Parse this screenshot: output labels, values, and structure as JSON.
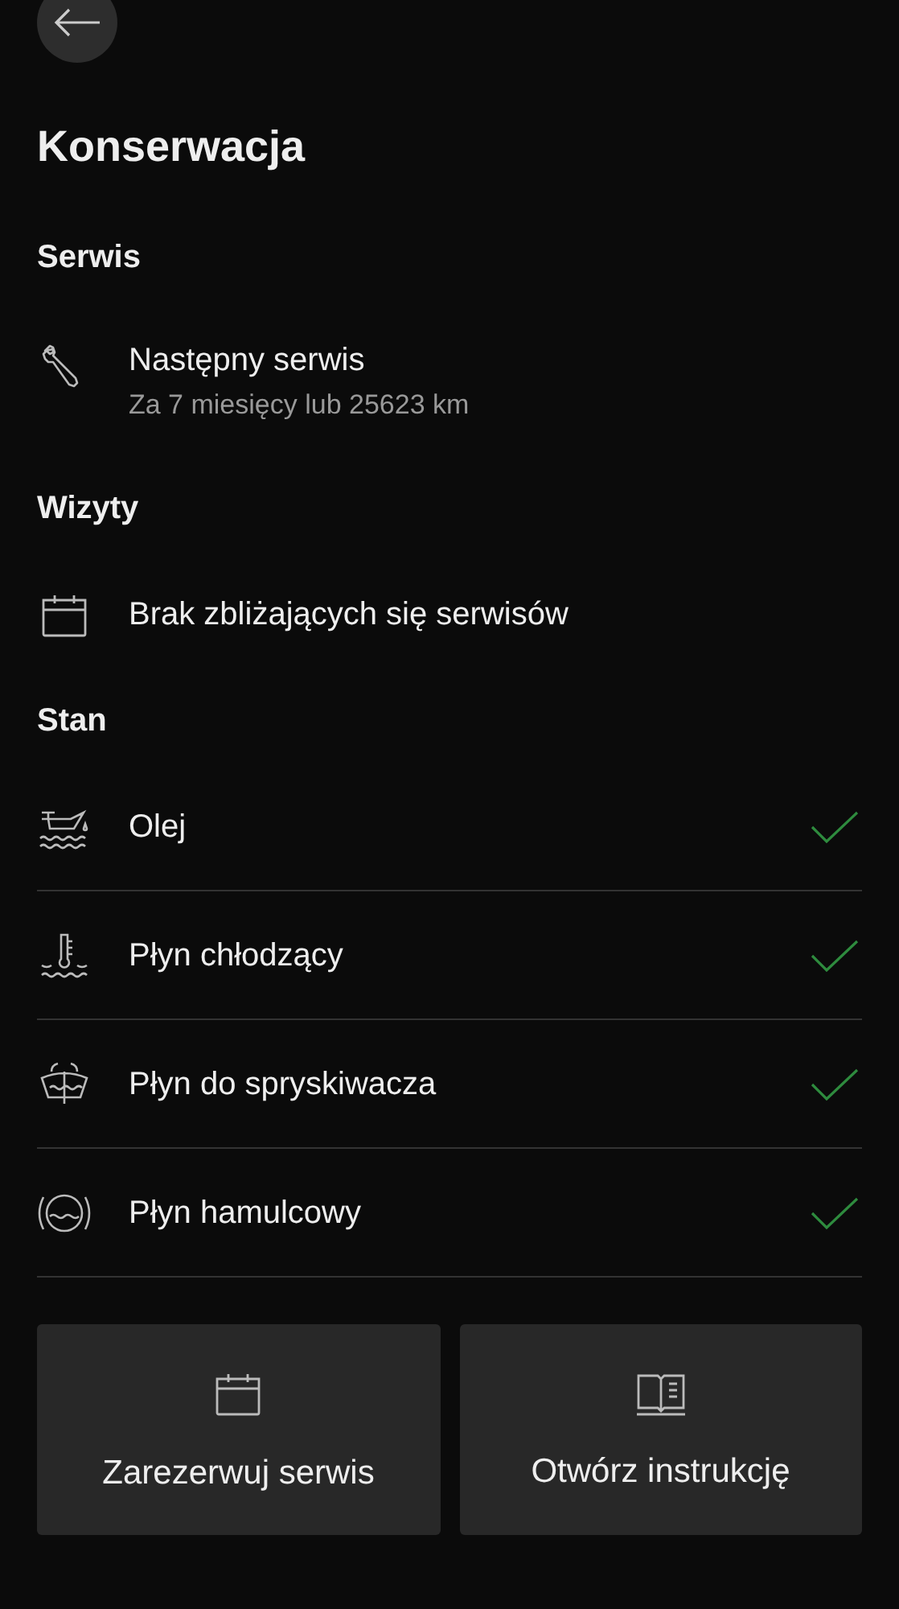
{
  "title": "Konserwacja",
  "service": {
    "heading": "Serwis",
    "title": "Następny serwis",
    "subtitle": "Za 7 miesięcy lub 25623 km"
  },
  "visits": {
    "heading": "Wizyty",
    "text": "Brak zbliżających się serwisów"
  },
  "status": {
    "heading": "Stan",
    "items": [
      {
        "kind": "oil",
        "label": "Olej",
        "ok": true
      },
      {
        "kind": "coolant",
        "label": "Płyn chłodzący",
        "ok": true
      },
      {
        "kind": "washer",
        "label": "Płyn do spryskiwacza",
        "ok": true
      },
      {
        "kind": "brake",
        "label": "Płyn hamulcowy",
        "ok": true
      }
    ]
  },
  "buttons": [
    {
      "kind": "calendar",
      "label": "Zarezerwuj serwis"
    },
    {
      "kind": "book",
      "label": "Otwórz instrukcję"
    }
  ]
}
